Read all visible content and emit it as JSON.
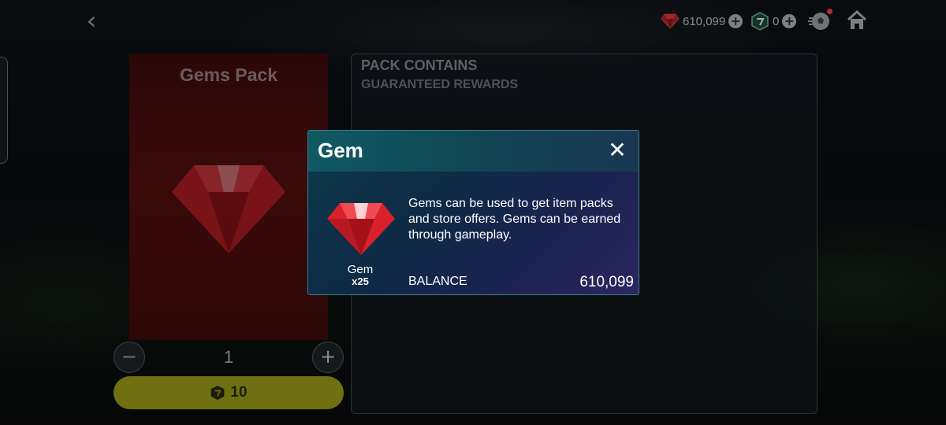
{
  "topbar": {
    "back_label": "‹",
    "gem_balance": "610,099",
    "token_balance": "0",
    "plus_label": "+"
  },
  "pack": {
    "title": "Gems Pack",
    "quantity": "1",
    "minus_label": "−",
    "plus_label": "+",
    "price": "10"
  },
  "contents": {
    "title": "PACK CONTAINS",
    "subtitle": "GUARANTEED REWARDS"
  },
  "modal": {
    "title": "Gem",
    "close_label": "✕",
    "item_name": "Gem",
    "item_qty": "x25",
    "description": "Gems can be used to get item packs and store offers. Gems can be earned through gameplay.",
    "balance_label": "BALANCE",
    "balance_value": "610,099"
  },
  "colors": {
    "gem_red": "#e0202a",
    "buy_button": "#6e7012",
    "modal_border": "#3a7c86"
  }
}
